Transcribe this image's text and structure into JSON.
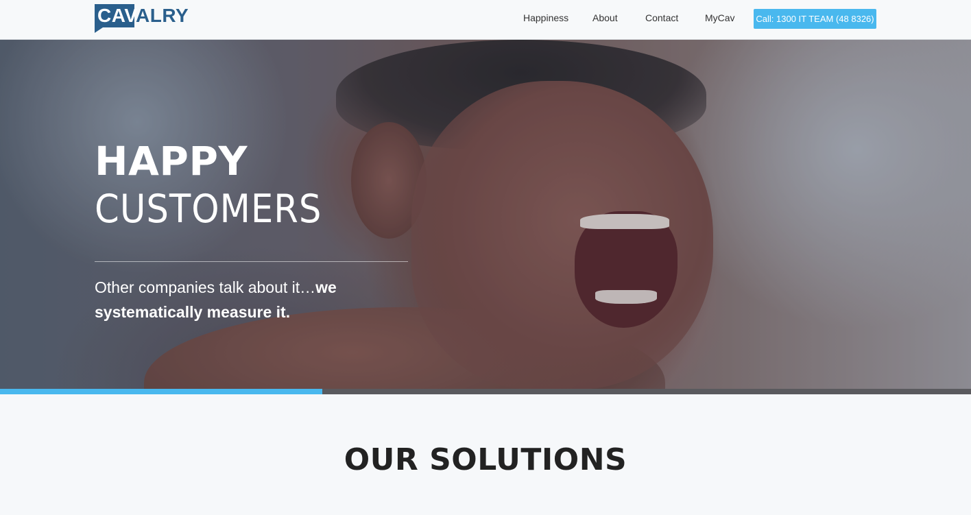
{
  "header": {
    "logo": {
      "part1": "CAV",
      "part2": "ALRY"
    },
    "nav": [
      {
        "label": "Happiness"
      },
      {
        "label": "About"
      },
      {
        "label": "Contact"
      },
      {
        "label": "MyCav"
      }
    ],
    "call_button": "Call: 1300 IT TEAM (48 8326)"
  },
  "hero": {
    "title_bold": "HAPPY",
    "title_light": "CUSTOMERS",
    "subtitle_regular": "Other companies talk about it…",
    "subtitle_bold_1": "we",
    "subtitle_bold_2": "systematically measure it.",
    "progress": 0.332
  },
  "solutions": {
    "title": "OUR SOLUTIONS"
  },
  "colors": {
    "brand": "#2a5f8c",
    "accent": "#49b8ee"
  }
}
